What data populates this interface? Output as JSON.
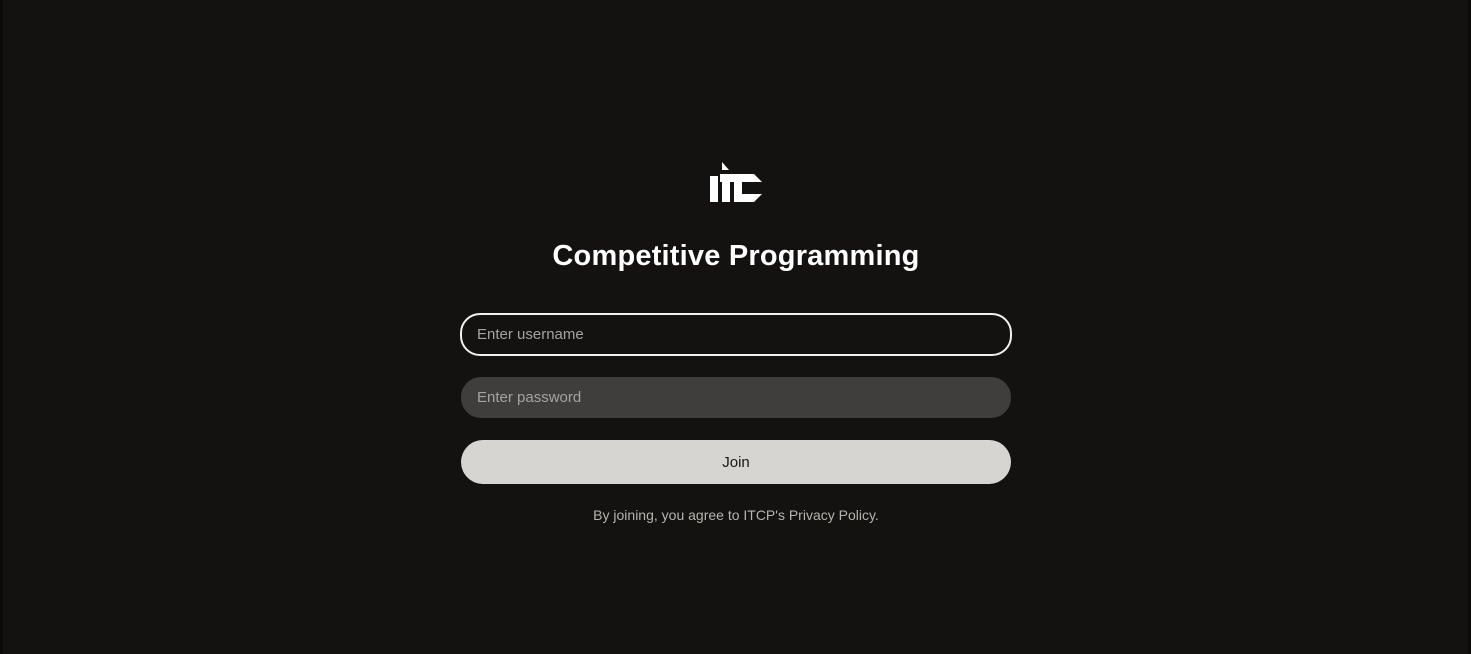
{
  "app": {
    "logo_text": "itc",
    "title": "Competitive Programming"
  },
  "form": {
    "username": {
      "value": "",
      "placeholder": "Enter username"
    },
    "password": {
      "value": "",
      "placeholder": "Enter password"
    },
    "join_label": "Join",
    "agreement_text": "By joining, you agree to ITCP's Privacy Policy."
  },
  "colors": {
    "background": "#141211",
    "title": "#ffffff",
    "input_focus_border": "#f2f0ec",
    "input_fill": "#403e3c",
    "button_fill": "#d7d5d1",
    "muted_text": "#b6b3ae"
  },
  "icons": {
    "logo": "itc-logo-icon"
  }
}
